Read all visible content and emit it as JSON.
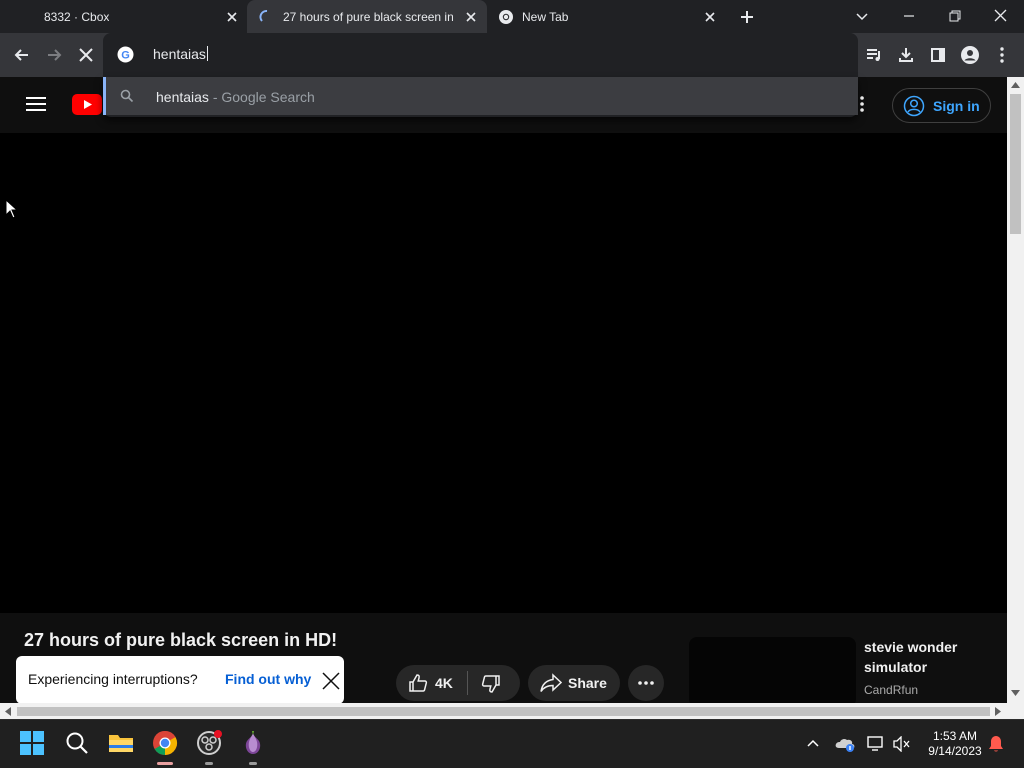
{
  "tabs": [
    {
      "title": "8332 · Cbox",
      "active": false,
      "icon": "none"
    },
    {
      "title": "27 hours of pure black screen in HD!",
      "active": true,
      "icon": "loading-spinner-icon"
    },
    {
      "title": "New Tab",
      "active": false,
      "icon": "chrome-icon"
    }
  ],
  "omnibox": {
    "value": "hentaias",
    "icon": "google-icon"
  },
  "suggestion": {
    "query": "hentaias",
    "suffix": " - Google Search",
    "icon": "search-icon"
  },
  "youtube": {
    "sign_in_label": "Sign in",
    "video_title": "27 hours of pure black screen in HD!",
    "likes": "4K",
    "share_label": "Share",
    "interruption_text": "Experiencing interruptions?",
    "interruption_link": "Find out why",
    "recommendation": {
      "title": "stevie wonder simulator",
      "channel": "CandRfun"
    }
  },
  "clock": {
    "time": "1:53 AM",
    "date": "9/14/2023"
  },
  "colors": {
    "accent_blue": "#3ea6ff",
    "youtube_red": "#ff0000",
    "link_blue": "#065fd4"
  }
}
